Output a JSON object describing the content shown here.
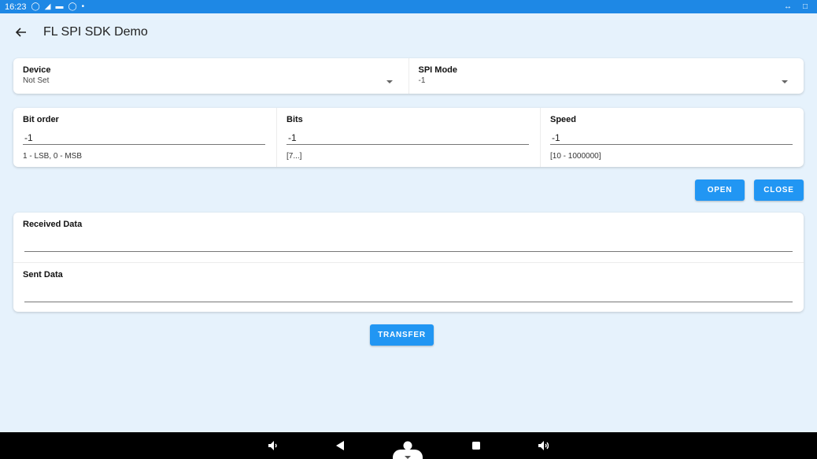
{
  "status_bar": {
    "time": "16:23"
  },
  "app_bar": {
    "title": "FL SPI SDK Demo"
  },
  "device": {
    "label": "Device",
    "value": "Not Set"
  },
  "spi_mode": {
    "label": "SPI Mode",
    "value": "-1"
  },
  "bit_order": {
    "label": "Bit order",
    "value": "-1",
    "hint": "1 - LSB, 0 - MSB"
  },
  "bits": {
    "label": "Bits",
    "value": "-1",
    "hint": "[7...]"
  },
  "speed": {
    "label": "Speed",
    "value": "-1",
    "hint": "[10 - 1000000]"
  },
  "buttons": {
    "open": "OPEN",
    "close": "CLOSE",
    "transfer": "TRANSFER"
  },
  "received": {
    "label": "Received Data",
    "value": ""
  },
  "sent": {
    "label": "Sent Data",
    "value": ""
  },
  "colors": {
    "accent": "#2196f3",
    "status_bar": "#1e88e5",
    "background": "#e6f2fc"
  },
  "icons": {
    "back": "arrow-back-icon",
    "volume_down": "volume-down-icon",
    "nav_back": "nav-back-icon",
    "home": "home-icon",
    "recents": "recents-icon",
    "volume_up": "volume-up-icon"
  }
}
